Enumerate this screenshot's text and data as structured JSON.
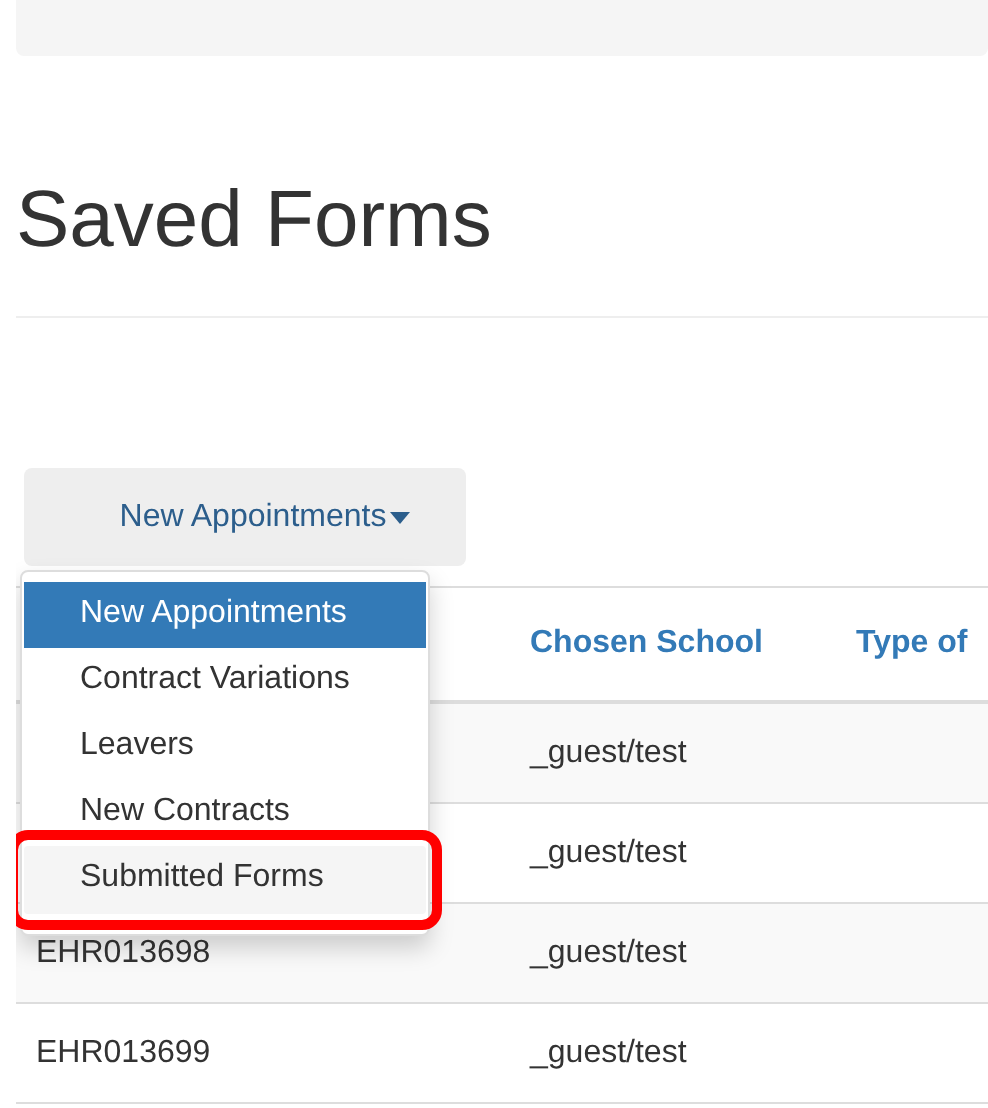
{
  "title": "Saved Forms",
  "dropdown": {
    "label": "New Appointments",
    "items": [
      {
        "label": "New Appointments",
        "selected": true,
        "highlighted": false
      },
      {
        "label": "Contract Variations",
        "selected": false,
        "highlighted": false
      },
      {
        "label": "Leavers",
        "selected": false,
        "highlighted": false
      },
      {
        "label": "New Contracts",
        "selected": false,
        "highlighted": false
      },
      {
        "label": "Submitted Forms",
        "selected": false,
        "highlighted": true
      }
    ]
  },
  "table": {
    "columns": [
      "Chosen School",
      "Type of"
    ],
    "rows": [
      {
        "school": "_guest/test"
      },
      {
        "school": "_guest/test"
      },
      {
        "id": "EHR013698",
        "school": "_guest/test"
      },
      {
        "id": "EHR013699",
        "school": "_guest/test"
      }
    ]
  }
}
